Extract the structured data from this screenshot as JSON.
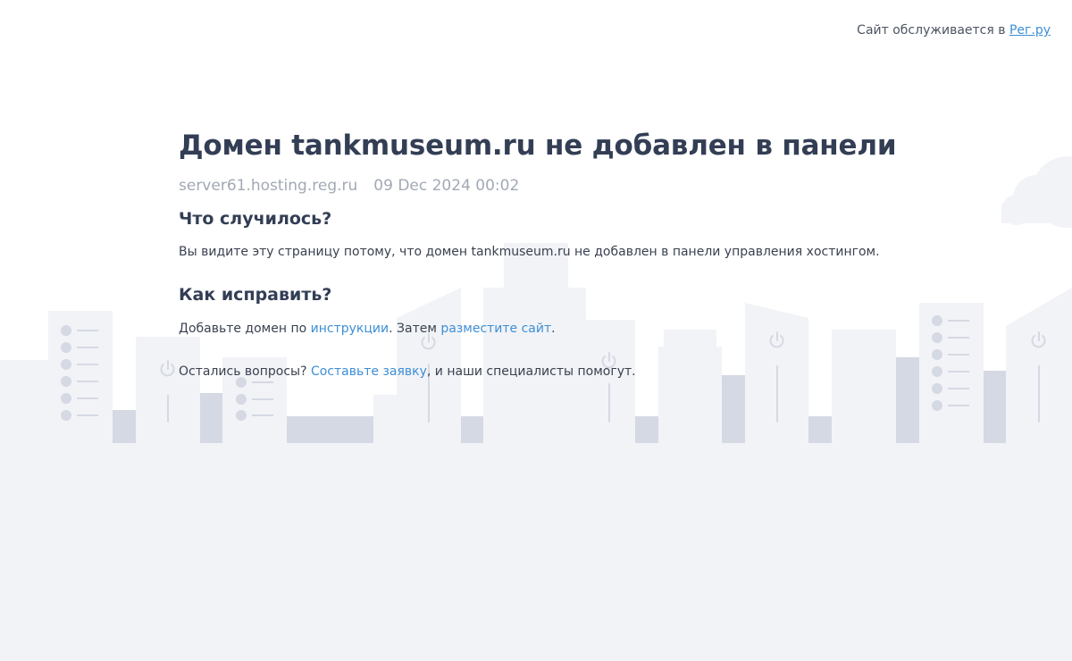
{
  "header": {
    "served_prefix": "Сайт обслуживается в",
    "served_link": "Рег.ру"
  },
  "main": {
    "title": "Домен tankmuseum.ru не добавлен в панели",
    "server": "server61.hosting.reg.ru",
    "timestamp": "09 Dec 2024 00:02",
    "what_happened_heading": "Что случилось?",
    "what_happened_text": "Вы видите эту страницу потому, что домен tankmuseum.ru не добавлен в панели управления хостингом.",
    "how_to_fix_heading": "Как исправить?",
    "fix_prefix": "Добавьте домен по ",
    "fix_link_instructions": "инструкции",
    "fix_middle": ". Затем ",
    "fix_link_place": "разместите сайт",
    "fix_suffix": ".",
    "questions_prefix": "Остались вопросы? ",
    "questions_link": "Составьте заявку",
    "questions_suffix": ", и наши специалисты помогут."
  },
  "colors": {
    "accent": "#3d8fd6",
    "heading": "#333e55",
    "muted": "#a2a9b5",
    "building_light": "#f2f3f7",
    "building_dark": "#d5d9e3"
  },
  "icons": [
    "cloud-icon",
    "power-icon",
    "server-rack-icon"
  ]
}
